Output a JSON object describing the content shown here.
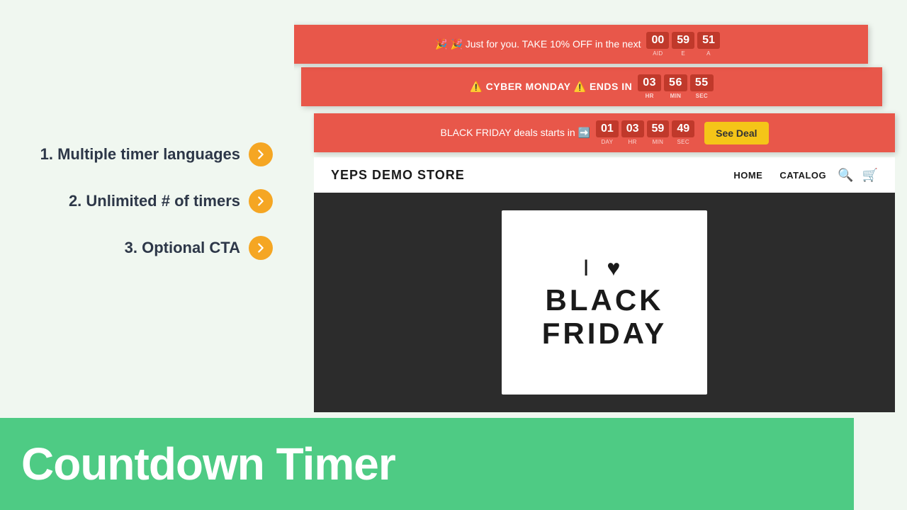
{
  "left": {
    "features": [
      {
        "id": "feature-1",
        "text": "1. Multiple timer languages"
      },
      {
        "id": "feature-2",
        "text": "2. Unlimited # of timers"
      },
      {
        "id": "feature-3",
        "text": "3. Optional CTA"
      }
    ],
    "arrow_label": "→"
  },
  "bottom_bar": {
    "title": "Countdown Timer"
  },
  "banner1": {
    "prefix": "🎉 🎉 Just for you. TAKE 10% OFF in the next",
    "time": {
      "hh": "00",
      "mm": "59",
      "ss": "51"
    },
    "labels": {
      "hh": "AID",
      "mm": "E",
      "ss": "A"
    }
  },
  "banner2": {
    "prefix": "⚠️  CYBER MONDAY ⚠️  ENDS IN",
    "time": {
      "hh": "03",
      "mm": "56",
      "ss": "55"
    },
    "labels": {
      "hh": "HR",
      "mm": "MIN",
      "ss": "SEC"
    }
  },
  "banner3": {
    "prefix": "BLACK FRIDAY deals starts in ➡️",
    "time": {
      "dd": "01",
      "hh": "03",
      "mm": "59",
      "ss": "49"
    },
    "labels": {
      "dd": "DAY",
      "hh": "HR",
      "mm": "MIN",
      "ss": "SEC"
    },
    "cta": "See Deal"
  },
  "store": {
    "logo": "YEPS DEMO STORE",
    "nav_home": "HOME",
    "nav_catalog": "CATALOG",
    "hero": {
      "line1": "I ♥",
      "line2": "BLACK",
      "line3": "FRIDAY"
    }
  }
}
